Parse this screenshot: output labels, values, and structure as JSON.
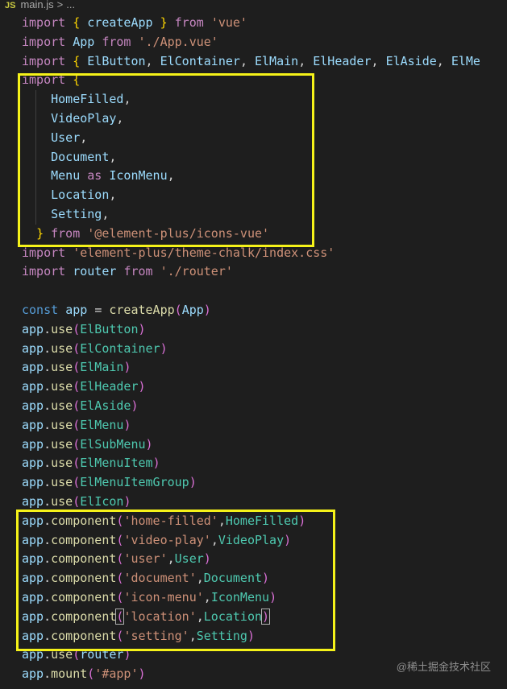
{
  "breadcrumb": {
    "file_icon": "JS",
    "file_name": "main.js",
    "separator": ">",
    "trail": "..."
  },
  "code_lines": [
    "import { createApp } from 'vue'",
    "import App from './App.vue'",
    "import { ElButton, ElContainer, ElMain, ElHeader, ElAside, ElMe",
    "import {",
    "    HomeFilled,",
    "    VideoPlay,",
    "    User,",
    "    Document,",
    "    Menu as IconMenu,",
    "    Location,",
    "    Setting,",
    "  } from '@element-plus/icons-vue'",
    "import 'element-plus/theme-chalk/index.css'",
    "import router from './router'",
    "",
    "const app = createApp(App)",
    "app.use(ElButton)",
    "app.use(ElContainer)",
    "app.use(ElMain)",
    "app.use(ElHeader)",
    "app.use(ElAside)",
    "app.use(ElMenu)",
    "app.use(ElSubMenu)",
    "app.use(ElMenuItem)",
    "app.use(ElMenuItemGroup)",
    "app.use(ElIcon)",
    "app.component('home-filled',HomeFilled)",
    "app.component('video-play',VideoPlay)",
    "app.component('user',User)",
    "app.component('document',Document)",
    "app.component('icon-menu',IconMenu)",
    "app.component('location',Location)",
    "app.component('setting',Setting)",
    "app.use(router)",
    "app.mount('#app')"
  ],
  "highlight_color": "#f5f219",
  "watermark": "@稀土掘金技术社区"
}
